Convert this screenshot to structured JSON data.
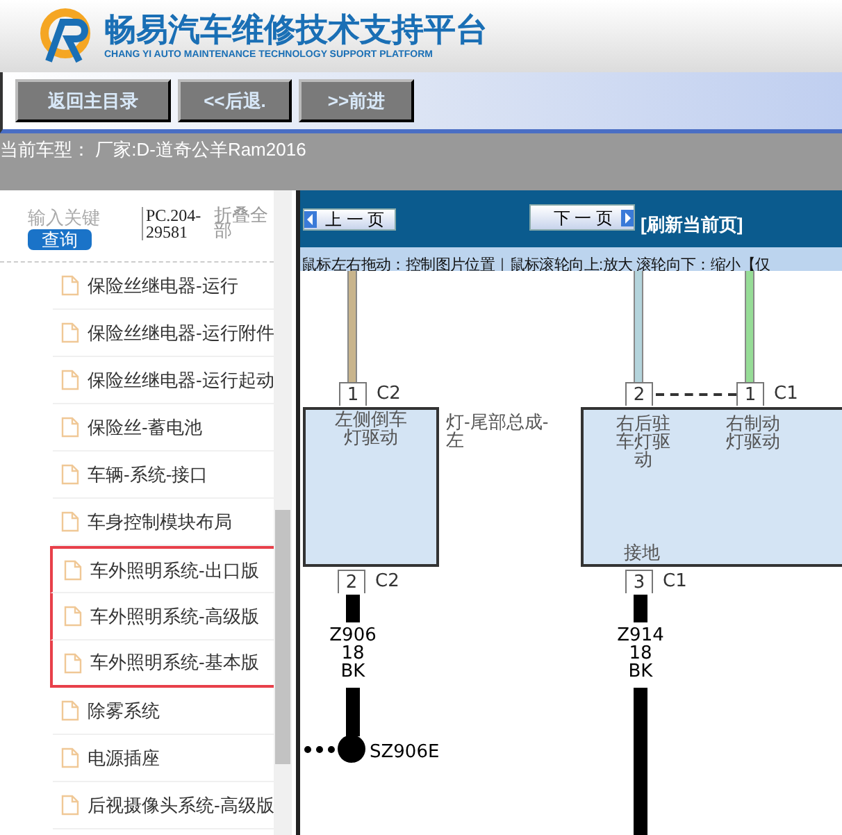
{
  "header": {
    "title": "畅易汽车维修技术支持平台",
    "subtitle": "CHANG YI AUTO MAINTENANCE TECHNOLOGY SUPPORT PLATFORM"
  },
  "toolbar": {
    "buttons": [
      "返回主目录",
      "<<后退.",
      ">>前进"
    ]
  },
  "vehicle": "当前车型：  厂家:D-道奇公羊Ram2016",
  "sidebar": {
    "search": {
      "placeholder": "输入关键"
    },
    "search_button": "查询",
    "code": "PC.204-29581",
    "collapse": "折叠全部",
    "items": [
      {
        "label": "保险丝继电器-运行",
        "highlighted": false
      },
      {
        "label": "保险丝继电器-运行附件",
        "highlighted": false
      },
      {
        "label": "保险丝继电器-运行起动",
        "highlighted": false
      },
      {
        "label": "保险丝-蓄电池",
        "highlighted": false
      },
      {
        "label": "车辆-系统-接口",
        "highlighted": false
      },
      {
        "label": "车身控制模块布局",
        "highlighted": false
      },
      {
        "label": "车外照明系统-出口版",
        "highlighted": true
      },
      {
        "label": "车外照明系统-高级版",
        "highlighted": true
      },
      {
        "label": "车外照明系统-基本版",
        "highlighted": true
      },
      {
        "label": "除雾系统",
        "highlighted": false
      },
      {
        "label": "电源插座",
        "highlighted": false
      },
      {
        "label": "后视摄像头系统-高级版",
        "highlighted": false
      }
    ]
  },
  "viewer": {
    "prev": "上 一 页",
    "next": "下 一 页",
    "refresh": "[刷新当前页]",
    "hint": "鼠标左右拖动：控制图片位置｜鼠标滚轮向上:放大  滚轮向下：缩小【仅",
    "diagram": {
      "top_pins": [
        {
          "pin": "1",
          "connector": "C2",
          "color": "#c8b48c"
        },
        {
          "pin": "2",
          "color": "#b4d4dc"
        },
        {
          "pin": "1",
          "connector": "C1",
          "color": "#96dc96"
        }
      ],
      "boxes": [
        {
          "labels": [
            "左侧倒车灯驱动"
          ]
        },
        {
          "labels": [
            "右后驻车灯驱动",
            "右制动灯驱动"
          ],
          "ground": "接地"
        }
      ],
      "assembly_label": "灯-尾部总成-左",
      "bottom_pins": [
        {
          "pin": "2",
          "connector": "C2",
          "wire": [
            "Z906",
            "18",
            "BK"
          ]
        },
        {
          "pin": "3",
          "connector": "C1",
          "wire": [
            "Z914",
            "18",
            "BK"
          ]
        }
      ],
      "splice": "SZ906E"
    }
  }
}
